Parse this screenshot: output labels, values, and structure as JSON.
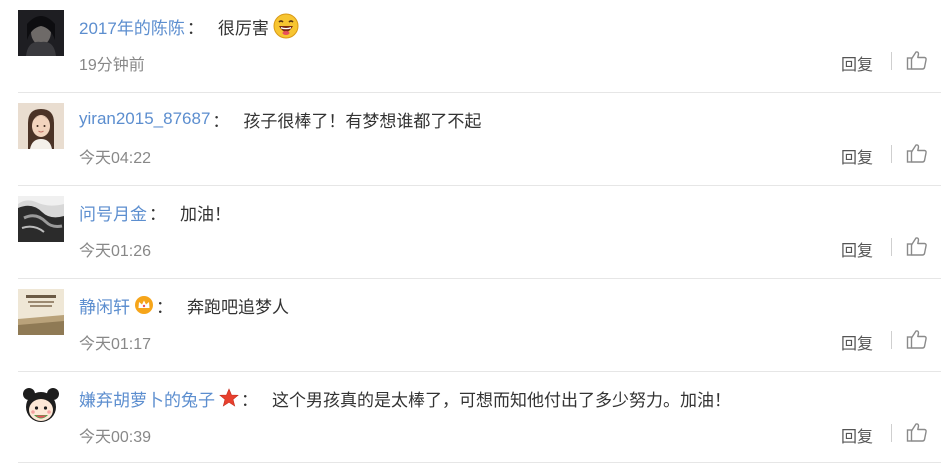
{
  "comments": [
    {
      "user": "2017年的陈陈",
      "colon": "：",
      "text": "很厉害",
      "time": "19分钟前",
      "reply_label": "回复",
      "avatar_icon": "avatar-dark-portrait",
      "emoji_icon": "laughing-face-icon"
    },
    {
      "user": "yiran2015_87687",
      "colon": "：",
      "text": "孩子很棒了！有梦想谁都了不起",
      "time": "今天04:22",
      "reply_label": "回复",
      "avatar_icon": "avatar-girl-photo"
    },
    {
      "user": "问号月金",
      "colon": "：",
      "text": "加油！",
      "time": "今天01:26",
      "reply_label": "回复",
      "avatar_icon": "avatar-hands-bw"
    },
    {
      "user": "静闲轩",
      "colon": "：",
      "text": "奔跑吧追梦人",
      "time": "今天01:17",
      "reply_label": "回复",
      "avatar_icon": "avatar-book-cover",
      "badge_icon": "crown-badge-icon"
    },
    {
      "user": "嫌弃胡萝卜的兔子",
      "colon": "：",
      "text": "这个男孩真的是太棒了，可想而知他付出了多少努力。加油！",
      "time": "今天00:39",
      "reply_label": "回复",
      "avatar_icon": "avatar-cartoon-girl",
      "badge_icon": "red-star-badge-icon"
    }
  ],
  "colors": {
    "username": "#5c8ecf",
    "text": "#333333",
    "meta": "#888888",
    "divider": "#e6e6e6"
  }
}
